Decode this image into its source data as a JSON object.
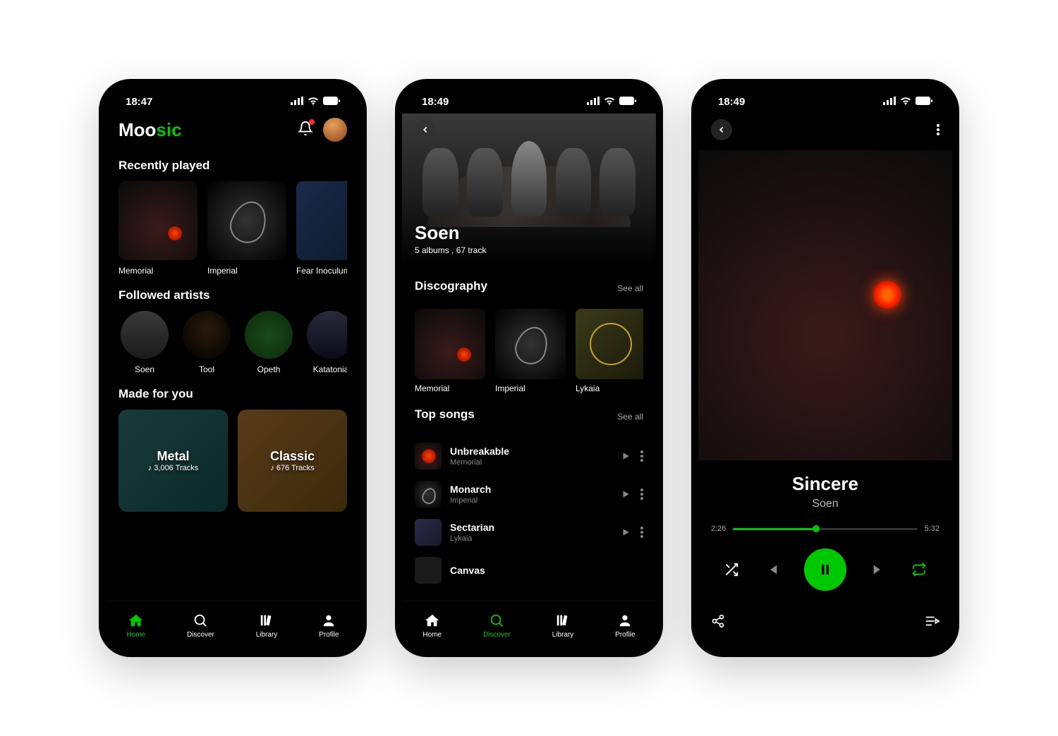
{
  "screen1": {
    "time": "18:47",
    "logo_moo": "Moo",
    "logo_sic": "sic",
    "recently_played_title": "Recently played",
    "recently_played": [
      {
        "title": "Memorial"
      },
      {
        "title": "Imperial"
      },
      {
        "title": "Fear Inoculum"
      }
    ],
    "followed_artists_title": "Followed artists",
    "followed_artists": [
      {
        "name": "Soen"
      },
      {
        "name": "Tool"
      },
      {
        "name": "Opeth"
      },
      {
        "name": "Katatonia"
      }
    ],
    "made_for_you_title": "Made for you",
    "made_for_you": [
      {
        "title": "Metal",
        "tracks": "♪ 3,006 Tracks"
      },
      {
        "title": "Classic",
        "tracks": "♪ 676 Tracks"
      }
    ],
    "nav": [
      "Home",
      "Discover",
      "Library",
      "Profile"
    ]
  },
  "screen2": {
    "time": "18:49",
    "artist_name": "Soen",
    "artist_sub": "5 albums , 67 track",
    "discography_title": "Discography",
    "see_all": "See all",
    "discography": [
      {
        "title": "Memorial"
      },
      {
        "title": "Imperial"
      },
      {
        "title": "Lykaia"
      }
    ],
    "top_songs_title": "Top songs",
    "songs": [
      {
        "title": "Unbreakable",
        "album": "Memorial"
      },
      {
        "title": "Monarch",
        "album": "Imperial"
      },
      {
        "title": "Sectarian",
        "album": "Lykaia"
      },
      {
        "title": "Canvas",
        "album": ""
      }
    ],
    "nav": [
      "Home",
      "Discover",
      "Library",
      "Profile"
    ]
  },
  "screen3": {
    "time": "18:49",
    "track_title": "Sincere",
    "track_artist": "Soen",
    "time_current": "2:26",
    "time_total": "5:32",
    "progress_pct": 45
  },
  "colors": {
    "accent": "#00c800"
  }
}
